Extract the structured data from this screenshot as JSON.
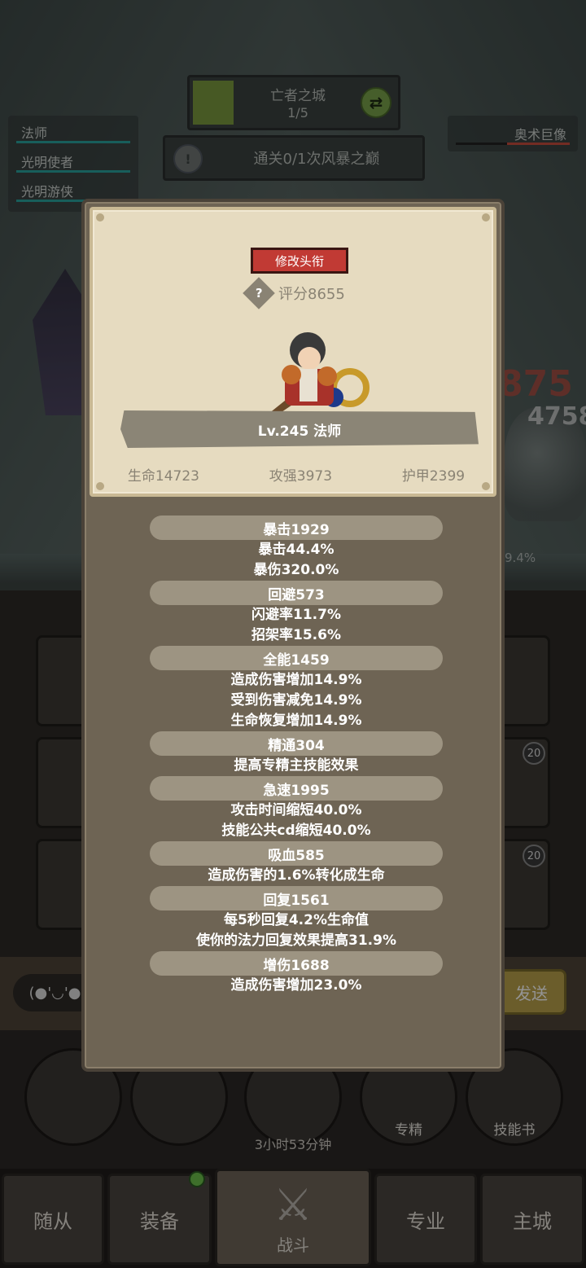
{
  "hud": {
    "dungeon_name": "亡者之城",
    "dungeon_progress": "1/5",
    "dungeon_progress_ratio": 0.2,
    "quest_text": "通关0/1次风暴之巅",
    "party": [
      "法师",
      "光明使者",
      "光明游侠"
    ],
    "boss_name": "奥术巨像",
    "boss_hp_ratio": 0.55,
    "damage_numbers": [
      "875",
      "4758"
    ],
    "pct_stub": "9.4%",
    "skill_badges": [
      "20",
      "20"
    ]
  },
  "chat": {
    "emoji": "(●'◡'●)",
    "send_label": "发送"
  },
  "actions": {
    "chest_timer": "3小时53分钟",
    "specialization_label": "专精",
    "skillbook_label": "技能书"
  },
  "tabs": {
    "followers": "随从",
    "equipment": "装备",
    "battle": "战斗",
    "profession": "专业",
    "main_city": "主城"
  },
  "profile": {
    "change_title_label": "修改头衔",
    "score": "评分8655",
    "level_class": "Lv.245 法师",
    "hp": "生命14723",
    "attack": "攻强3973",
    "armor": "护甲2399"
  },
  "stats": [
    {
      "header": "暴击1929",
      "lines": [
        "暴击44.4%",
        "暴伤320.0%"
      ]
    },
    {
      "header": "回避573",
      "lines": [
        "闪避率11.7%",
        "招架率15.6%"
      ]
    },
    {
      "header": "全能1459",
      "lines": [
        "造成伤害增加14.9%",
        "受到伤害减免14.9%",
        "生命恢复增加14.9%"
      ]
    },
    {
      "header": "精通304",
      "lines": [
        "提高专精主技能效果"
      ]
    },
    {
      "header": "急速1995",
      "lines": [
        "攻击时间缩短40.0%",
        "技能公共cd缩短40.0%"
      ]
    },
    {
      "header": "吸血585",
      "lines": [
        "造成伤害的1.6%转化成生命"
      ]
    },
    {
      "header": "回复1561",
      "lines": [
        "每5秒回复4.2%生命值",
        "使你的法力回复效果提高31.9%"
      ]
    },
    {
      "header": "增伤1688",
      "lines": [
        "造成伤害增加23.0%"
      ]
    }
  ],
  "colors": {
    "modal_bg": "#6e6454",
    "parchment": "#e6dbc0",
    "title_button": "#c13a34",
    "party_bar": "#2aa39d",
    "boss_bar": "#c74c3d"
  }
}
